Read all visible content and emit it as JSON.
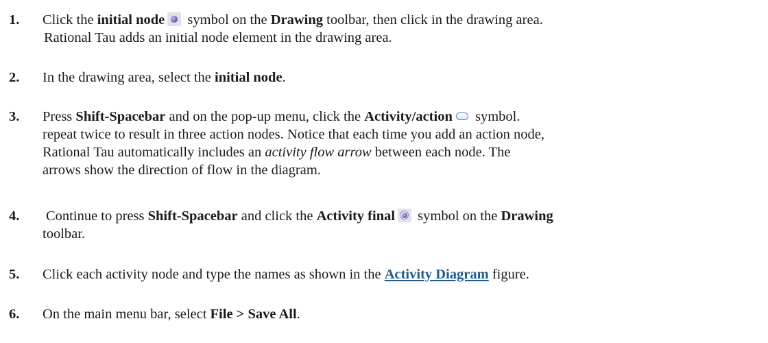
{
  "steps": [
    {
      "number": "1.",
      "lines": [
        {
          "a": "Click the ",
          "b": "initial node",
          "c": " symbol on the ",
          "d": "Drawing",
          "e": " toolbar, then click in the drawing area."
        },
        {
          "a": " Rational Tau adds an initial node element in the drawing area."
        }
      ]
    },
    {
      "number": "2.",
      "lines": [
        {
          "a": "In the drawing area, select the ",
          "b": "initial node",
          "c": "."
        }
      ]
    },
    {
      "number": "3.",
      "lines": [
        {
          "a": "Press ",
          "b": "Shift-Spacebar",
          "c": " and on the pop-up menu, click the ",
          "d": "Activity/action",
          "e": " symbol."
        },
        {
          "a": "repeat twice to result in three action nodes. Notice that each time you add an action node,"
        },
        {
          "a": "Rational Tau automatically includes an ",
          "b": "activity flow arrow",
          "c": " between each node. The"
        },
        {
          "a": "arrows show the direction of flow in the diagram."
        }
      ]
    },
    {
      "number": "4.",
      "lines": [
        {
          "a": "Continue to press ",
          "b": "Shift-Spacebar",
          "c": " and click the ",
          "d": "Activity final",
          "e": " symbol on the ",
          "f": "Drawing"
        },
        {
          "a": "toolbar."
        }
      ]
    },
    {
      "number": "5.",
      "lines": [
        {
          "a": "Click each activity node and type the names as shown in the ",
          "b": "Activity Diagram",
          "c": " figure."
        }
      ]
    },
    {
      "number": "6.",
      "lines": [
        {
          "a": "On the main menu bar, select ",
          "b": "File > Save All",
          "c": "."
        }
      ]
    }
  ],
  "icons": {
    "initial_node": "initial-node-icon",
    "activity_action": "activity-action-icon",
    "activity_final": "activity-final-icon"
  },
  "colors": {
    "link": "#1f5b8f",
    "text": "#1a1a1a",
    "background": "#ffffff"
  }
}
